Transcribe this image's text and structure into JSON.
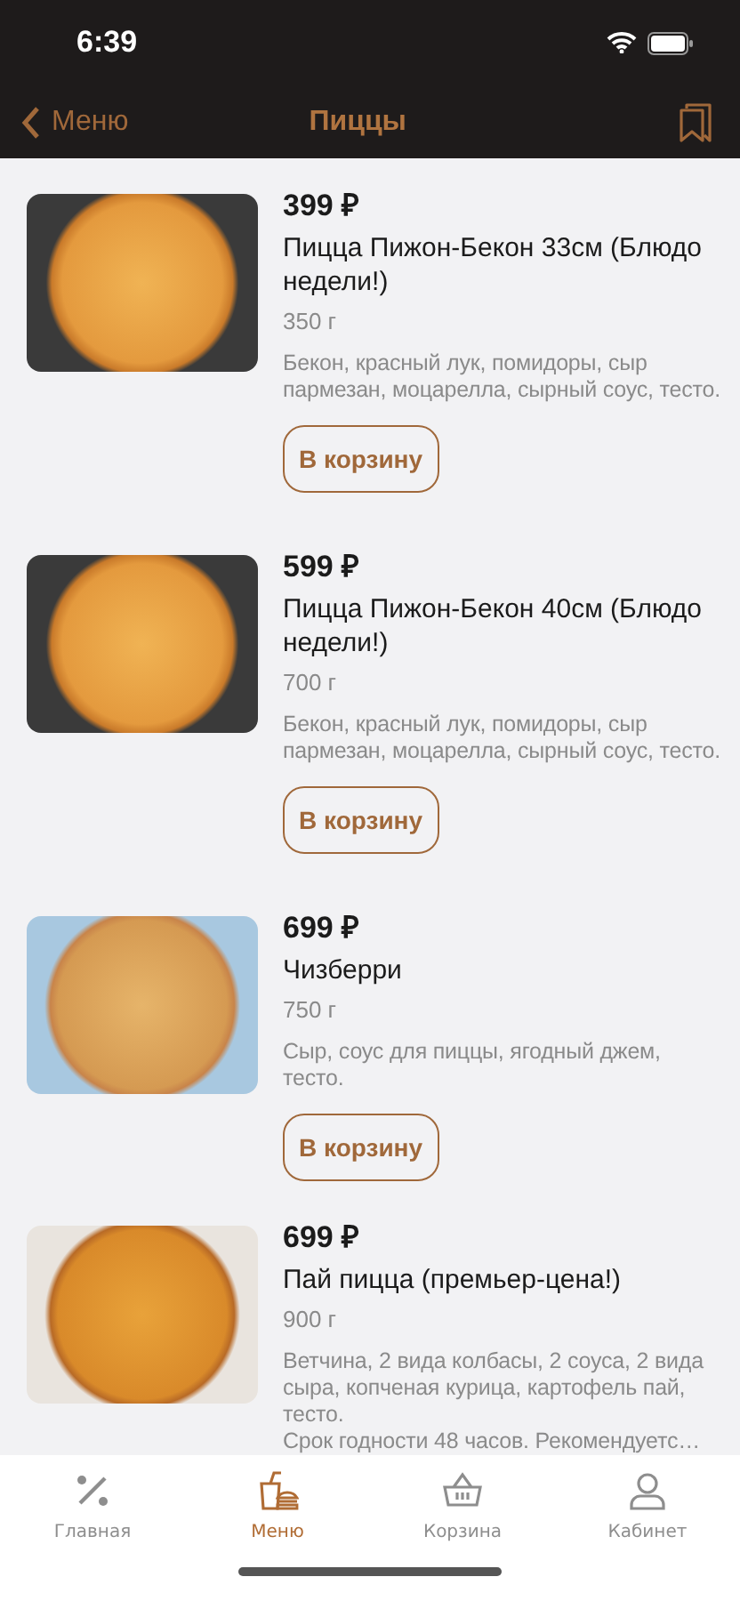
{
  "status_bar": {
    "time": "6:39"
  },
  "nav_bar": {
    "back": "Меню",
    "title": "Пиццы"
  },
  "products": [
    {
      "price": "399 ₽",
      "name": "Пицца Пижон-Бекон 33см (Блюдо недели!)",
      "weight": "350 г",
      "description": "Бекон, красный лук, помидоры, сыр пармезан, моцарелла, сырный соус, тесто.",
      "button": "В корзину"
    },
    {
      "price": "599 ₽",
      "name": "Пицца Пижон-Бекон 40см (Блюдо недели!)",
      "weight": "700 г",
      "description": "Бекон, красный лук, помидоры, сыр пармезан, моцарелла, сырный соус, тесто.",
      "button": "В корзину"
    },
    {
      "price": "699 ₽",
      "name": "Чизберри",
      "weight": "750 г",
      "description": "Сыр, соус для пиццы, ягодный джем, тесто.",
      "button": "В корзину"
    },
    {
      "price": "699 ₽",
      "name": "Пай пицца (премьер-цена!)",
      "weight": "900 г",
      "description": "Ветчина, 2 вида колбасы, 2 соуса, 2 вида сыра, копченая курица, картофель пай, тесто.\nСрок годности 48 часов. Рекомендуетс…"
    }
  ],
  "tab_bar": [
    {
      "label": "Главная",
      "selected": false
    },
    {
      "label": "Меню",
      "selected": true
    },
    {
      "label": "Корзина",
      "selected": false
    },
    {
      "label": "Кабинет",
      "selected": false
    }
  ]
}
